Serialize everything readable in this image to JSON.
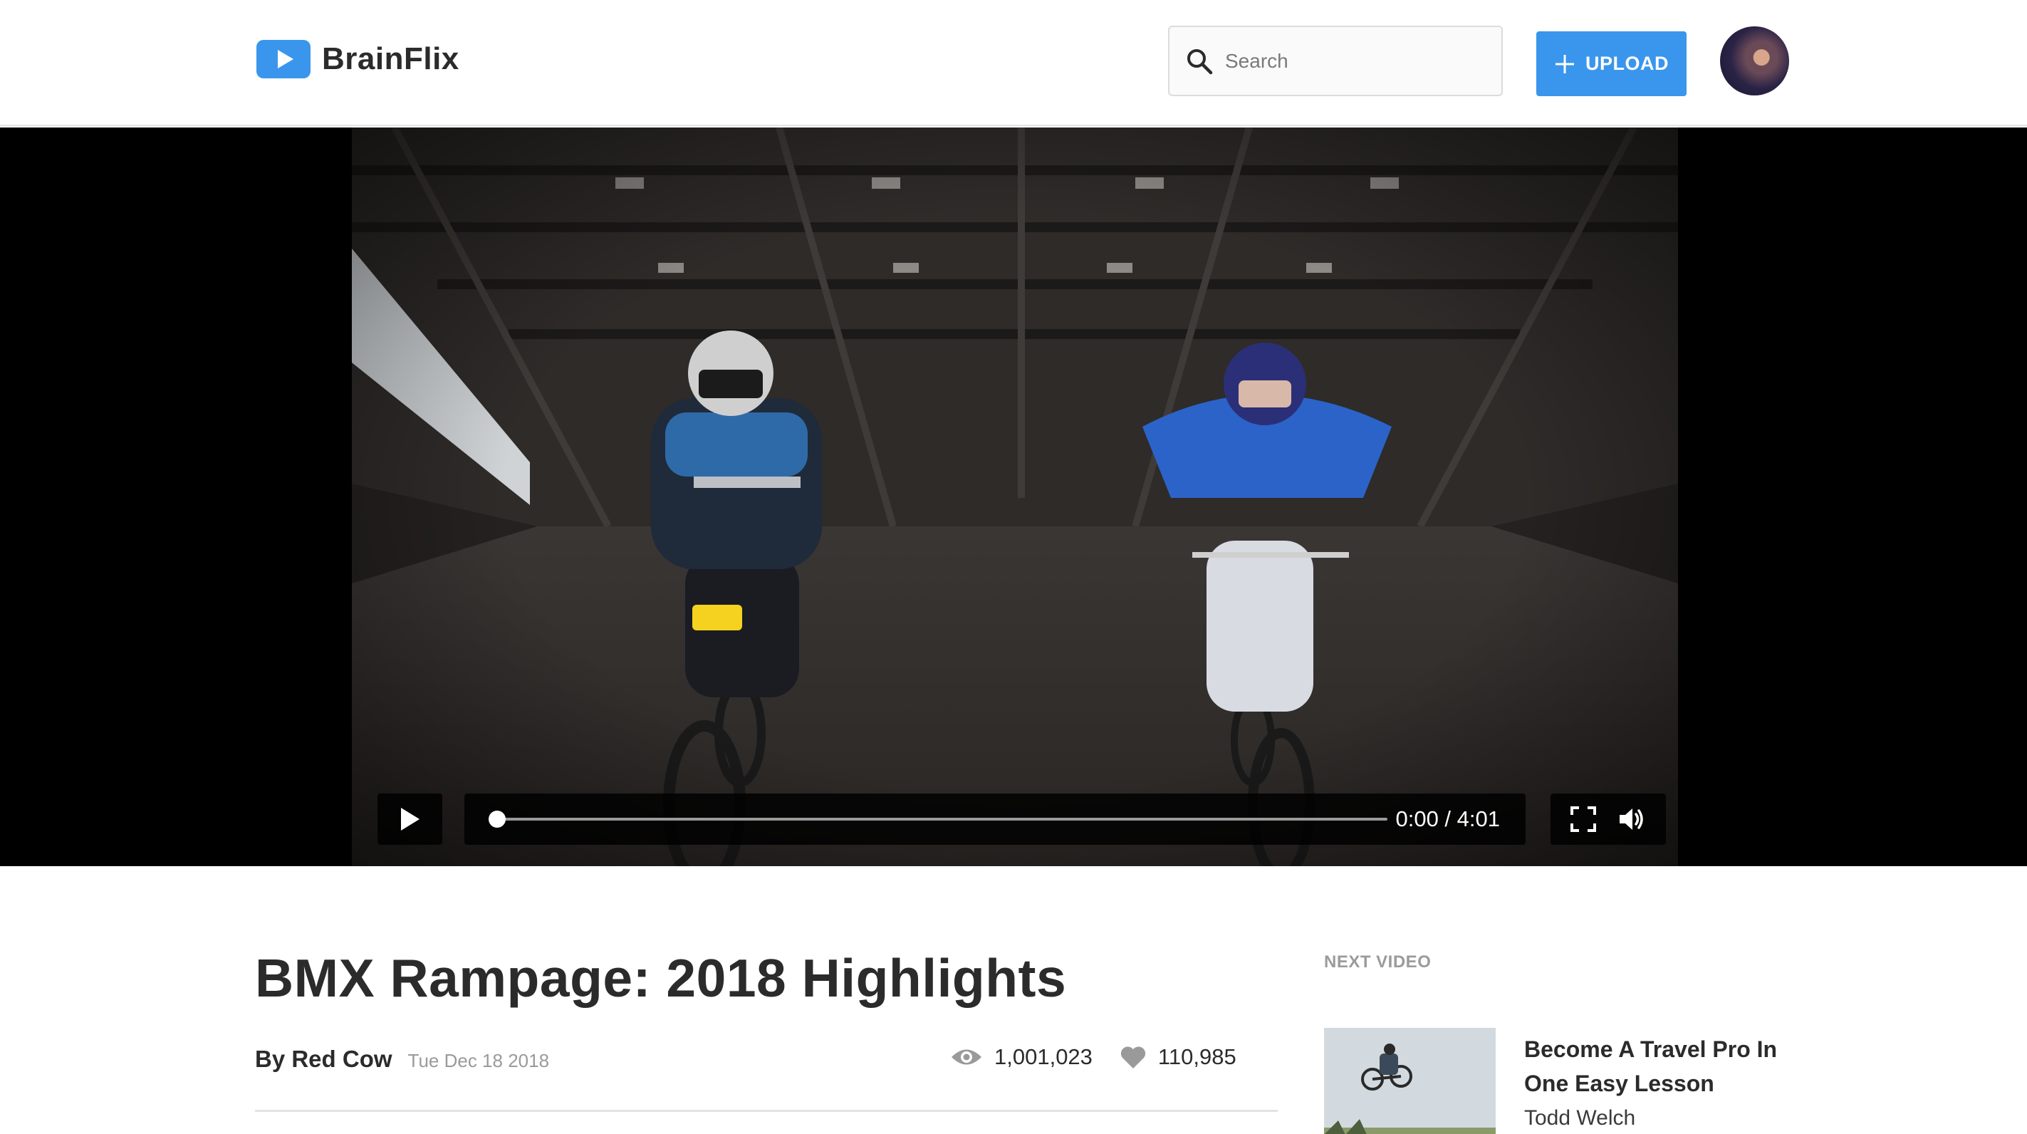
{
  "header": {
    "brand": "BrainFlix",
    "search_placeholder": "Search",
    "upload_label": "UPLOAD"
  },
  "player": {
    "time": "0:00 / 4:01",
    "progress": 0.0
  },
  "video": {
    "title": "BMX Rampage: 2018 Highlights",
    "author": "By Red Cow",
    "date": "Tue Dec 18 2018",
    "views": "1,001,023",
    "likes": "110,985"
  },
  "sidebar": {
    "next_label": "NEXT VIDEO",
    "items": [
      {
        "title": "Become A Travel Pro In One Easy Lesson",
        "author": "Todd Welch"
      }
    ]
  },
  "colors": {
    "accent": "#3a96ec",
    "text": "#2b2b2b",
    "muted": "#9a9a9a"
  },
  "icons": [
    "play-icon",
    "search-icon",
    "plus-icon",
    "fullscreen-icon",
    "volume-icon",
    "eye-icon",
    "heart-icon"
  ]
}
